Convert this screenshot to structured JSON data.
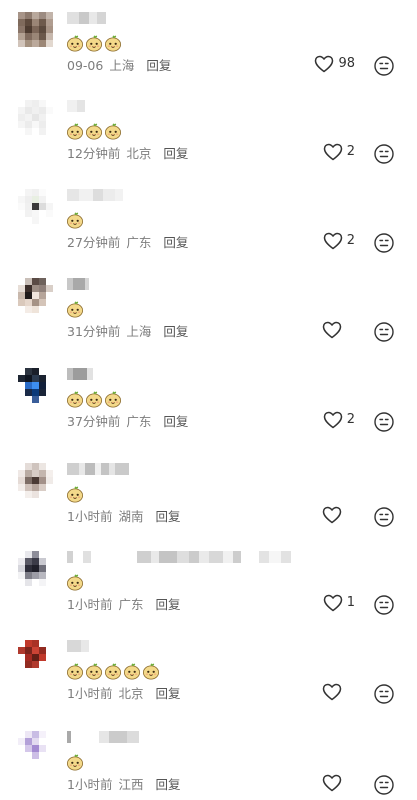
{
  "colors": {
    "meta_text": "#7d7d7d",
    "reply_text": "#555555",
    "icon_stroke": "#333333",
    "emoji_face": "#f3d98a",
    "emoji_leaf": "#6fae3a"
  },
  "icons": {
    "like": "heart-outline-icon",
    "dislike": "neutral-face-icon",
    "emoji": "bread-face-sticker"
  },
  "comments": [
    {
      "time": "09-06",
      "location": "上海",
      "reply": "回复",
      "likes": "98",
      "emoji_count": 3,
      "avatar": [
        "#a79488",
        "#8d7a6e",
        "#b8a89c",
        "#9c8b81",
        "#c2b4aa",
        "#7f6a5c",
        "#5e4a3d",
        "#9a8576",
        "#6e5a4c",
        "#b09d90",
        "#8a7568",
        "#4d3b30",
        "#7c6658",
        "#5c4a3e",
        "#a89486",
        "#b3a193",
        "#806b5e",
        "#9a8677",
        "#6b584b",
        "#c7b8ad",
        "#d1c4ba",
        "#a4917f",
        "#bba99b",
        "#9c8776",
        "#e2d8cf"
      ],
      "name": [
        [
          "#e0e0e0",
          12
        ],
        [
          "#c9c9c9",
          10
        ],
        [
          "#e8e8e8",
          8
        ],
        [
          "#d5d5d5",
          9
        ]
      ]
    },
    {
      "time": "12分钟前",
      "location": "北京",
      "reply": "回复",
      "likes": "2",
      "emoji_count": 3,
      "avatar": [
        "#ffffff",
        "#f2f2f2",
        "#eeeeee",
        "#f7f7f7",
        "#ffffff",
        "#f4f4f4",
        "#e9e9e9",
        "#f0f0f0",
        "#ebebeb",
        "#fafafa",
        "#eeeeee",
        "#f3f3f3",
        "#e6e6e6",
        "#f1f1f1",
        "#ffffff",
        "#f5f5f5",
        "#ececec",
        "#f8f8f8",
        "#ededed",
        "#ffffff",
        "#ffffff",
        "#f6f6f6",
        "#ffffff",
        "#f2f2f2",
        "#ffffff"
      ],
      "name": [
        [
          "#f0f0f0",
          10
        ],
        [
          "#e4e4e4",
          8
        ]
      ]
    },
    {
      "time": "27分钟前",
      "location": "广东",
      "reply": "回复",
      "likes": "2",
      "emoji_count": 1,
      "avatar": [
        "#ffffff",
        "#f4f4f4",
        "#f0f0f0",
        "#fbfbfb",
        "#ffffff",
        "#f6f6f6",
        "#eeeeee",
        "#e8efe2",
        "#f2f2f2",
        "#ffffff",
        "#fafafa",
        "#f0f0f0",
        "#3a3a3a",
        "#dcdcdc",
        "#f5f5f5",
        "#ffffff",
        "#f2f2f2",
        "#f7f7f7",
        "#ffffff",
        "#fafafa",
        "#ffffff",
        "#ffffff",
        "#f6f6f6",
        "#ffffff",
        "#ffffff"
      ],
      "name": [
        [
          "#e6e6e6",
          12
        ],
        [
          "#f1f1f1",
          14
        ],
        [
          "#dddddd",
          10
        ],
        [
          "#ececec",
          12
        ],
        [
          "#f2f2f2",
          8
        ]
      ]
    },
    {
      "time": "31分钟前",
      "location": "上海",
      "reply": "回复",
      "likes": "",
      "emoji_count": 1,
      "avatar": [
        "#ffffff",
        "#c9bfb8",
        "#5a4b45",
        "#6e625c",
        "#ffffff",
        "#e7ded7",
        "#3b2e2a",
        "#9c8d84",
        "#8f807a",
        "#d9cfc8",
        "#c8b8ac",
        "#1f1a1a",
        "#efe4dc",
        "#b6a59a",
        "#ffffff",
        "#dac9bc",
        "#e6d7cc",
        "#a69386",
        "#d4c4b8",
        "#ffffff",
        "#ffffff",
        "#f4ece6",
        "#efe4da",
        "#ffffff",
        "#ffffff"
      ],
      "name": [
        [
          "#c8c8c8",
          6
        ],
        [
          "#a9a9a9",
          12
        ],
        [
          "#d6d6d6",
          4
        ]
      ]
    },
    {
      "time": "37分钟前",
      "location": "广东",
      "reply": "回复",
      "likes": "2",
      "emoji_count": 3,
      "avatar": [
        "#ffffff",
        "#2c3440",
        "#1a1f2a",
        "#ffffff",
        "#ffffff",
        "#1e2633",
        "#0f1520",
        "#2b3a4f",
        "#1a2230",
        "#ffffff",
        "#ffffff",
        "#2a6cc8",
        "#3d8ef0",
        "#12203a",
        "#ffffff",
        "#ffffff",
        "#1a2a48",
        "#0b3a7a",
        "#1a2438",
        "#ffffff",
        "#ffffff",
        "#ffffff",
        "#3a5e9a",
        "#ffffff",
        "#ffffff"
      ],
      "name": [
        [
          "#bdbdbd",
          6
        ],
        [
          "#9c9c9c",
          14
        ],
        [
          "#e2e2e2",
          6
        ]
      ]
    },
    {
      "time": "1小时前",
      "location": "湖南",
      "reply": "回复",
      "likes": "",
      "emoji_count": 1,
      "avatar": [
        "#ffffff",
        "#e4dcd8",
        "#cfc4be",
        "#ece6e2",
        "#ffffff",
        "#efe8e5",
        "#b9aba3",
        "#d8ccc6",
        "#c4b6ae",
        "#f4efec",
        "#e5dbd6",
        "#7d6d66",
        "#4b3a34",
        "#a39189",
        "#f0ebe8",
        "#f2ece9",
        "#cfc1ba",
        "#b6a59c",
        "#d9cdc6",
        "#ffffff",
        "#ffffff",
        "#f4efec",
        "#ebe3df",
        "#ffffff",
        "#ffffff"
      ],
      "name": [
        [
          "#cfcfcf",
          12
        ],
        [
          "#e8e8e8",
          6
        ],
        [
          "#bcbcbc",
          10
        ],
        [
          "#f0f0f0",
          6
        ],
        [
          "#c4c4c4",
          8
        ],
        [
          "#e5e5e5",
          6
        ],
        [
          "#cacaca",
          14
        ]
      ]
    },
    {
      "time": "1小时前",
      "location": "广东",
      "reply": "回复",
      "likes": "1",
      "emoji_count": 1,
      "avatar": [
        "#ffffff",
        "#e8e8ec",
        "#8e8e9a",
        "#ffffff",
        "#ffffff",
        "#ecebef",
        "#5a5a66",
        "#3b3b48",
        "#c9c9d0",
        "#ffffff",
        "#d6d6dc",
        "#2e2e3a",
        "#1f1f2a",
        "#6f6f7a",
        "#ffffff",
        "#f2f2f4",
        "#7e7e88",
        "#9c9ca6",
        "#b8b8c0",
        "#ffffff",
        "#ffffff",
        "#e5e5e9",
        "#ffffff",
        "#f4f4f6",
        "#ffffff"
      ],
      "name": [
        [
          "#d2d2d2",
          6
        ],
        [
          "#ffffff",
          10
        ],
        [
          "#e0e0e0",
          8
        ],
        [
          "#ffffff",
          46
        ],
        [
          "#cfcfcf",
          14
        ],
        [
          "#e9e9e9",
          8
        ],
        [
          "#c4c4c4",
          18
        ],
        [
          "#dedede",
          12
        ],
        [
          "#cbcbcb",
          10
        ],
        [
          "#eaeaea",
          10
        ],
        [
          "#d8d8d8",
          14
        ],
        [
          "#f1f1f1",
          10
        ],
        [
          "#cdcdcd",
          8
        ],
        [
          "#ffffff",
          18
        ],
        [
          "#e3e3e3",
          10
        ],
        [
          "#f6f6f6",
          12
        ],
        [
          "#e2e2e2",
          10
        ]
      ]
    },
    {
      "time": "1小时前",
      "location": "北京",
      "reply": "回复",
      "likes": "",
      "emoji_count": 5,
      "avatar": [
        "#ffffff",
        "#c0392b",
        "#a93226",
        "#ffffff",
        "#ffffff",
        "#b03a2e",
        "#7b241c",
        "#cb4335",
        "#922b21",
        "#ffffff",
        "#ffffff",
        "#a52a22",
        "#641e16",
        "#c0392b",
        "#ffffff",
        "#ffffff",
        "#922b21",
        "#b03a2e",
        "#ffffff",
        "#ffffff",
        "#ffffff",
        "#ffffff",
        "#ffffff",
        "#ffffff",
        "#ffffff"
      ],
      "name": [
        [
          "#d8d8d8",
          14
        ],
        [
          "#e8e8e8",
          8
        ]
      ]
    },
    {
      "time": "1小时前",
      "location": "江西",
      "reply": "回复",
      "likes": "",
      "emoji_count": 1,
      "avatar": [
        "#ffffff",
        "#ede7f5",
        "#c9bde4",
        "#f5f1fa",
        "#ffffff",
        "#f2eef8",
        "#b3a0d8",
        "#e3dbf0",
        "#ffffff",
        "#ffffff",
        "#ffffff",
        "#d4c7ea",
        "#a48bd2",
        "#e9e2f4",
        "#ffffff",
        "#ffffff",
        "#ffffff",
        "#cdbfe6",
        "#ffffff",
        "#ffffff",
        "#ffffff",
        "#ffffff",
        "#ffffff",
        "#ffffff",
        "#ffffff"
      ],
      "name": [
        [
          "#a9a9a9",
          4
        ],
        [
          "#ffffff",
          28
        ],
        [
          "#e6e6e6",
          10
        ],
        [
          "#cbcbcb",
          18
        ],
        [
          "#dcdcdc",
          12
        ]
      ]
    }
  ]
}
